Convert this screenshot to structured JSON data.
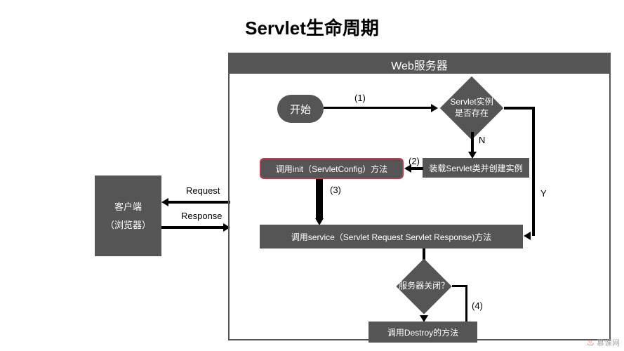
{
  "title": "Servlet生命周期",
  "client": {
    "line1": "客户端",
    "line2": "（浏览器）"
  },
  "server_header": "Web服务器",
  "nodes": {
    "start": "开始",
    "exists_l1": "Servlet实例",
    "exists_l2": "是否存在",
    "load": "装载Servlet类并创建实例",
    "init": "调用init（ServletConfig）方法",
    "service": "调用service（Servlet Request Servlet Response)方法",
    "shutdown": "服务器关闭？",
    "destroy": "调用Destroy的方法"
  },
  "labels": {
    "request": "Request",
    "response": "Response",
    "step1": "(1)",
    "step2": "(2)",
    "step3": "(3)",
    "step4": "(4)",
    "N": "N",
    "Y": "Y"
  },
  "watermark": "慕课网",
  "chart_data": {
    "type": "flowchart",
    "title": "Servlet生命周期",
    "container": "Web服务器",
    "external": {
      "id": "client",
      "label": "客户端（浏览器）"
    },
    "nodes": [
      {
        "id": "start",
        "shape": "terminator",
        "label": "开始"
      },
      {
        "id": "exists",
        "shape": "decision",
        "label": "Servlet实例是否存在"
      },
      {
        "id": "load",
        "shape": "process",
        "label": "装载Servlet类并创建实例"
      },
      {
        "id": "init",
        "shape": "process",
        "label": "调用init（ServletConfig）方法",
        "highlighted": true
      },
      {
        "id": "service",
        "shape": "process",
        "label": "调用service（Servlet Request Servlet Response)方法"
      },
      {
        "id": "shutdown",
        "shape": "decision",
        "label": "服务器关闭？"
      },
      {
        "id": "destroy",
        "shape": "process",
        "label": "调用Destroy的方法"
      }
    ],
    "edges": [
      {
        "from": "start",
        "to": "exists",
        "label": "(1)"
      },
      {
        "from": "exists",
        "to": "load",
        "label": "N"
      },
      {
        "from": "exists",
        "to": "service",
        "label": "Y"
      },
      {
        "from": "load",
        "to": "init",
        "label": "(2)"
      },
      {
        "from": "init",
        "to": "service",
        "label": "(3)"
      },
      {
        "from": "service",
        "to": "shutdown",
        "label": ""
      },
      {
        "from": "shutdown",
        "to": "destroy",
        "label": "(4)"
      },
      {
        "from": "client",
        "to": "server",
        "label": "Request"
      },
      {
        "from": "server",
        "to": "client",
        "label": "Response"
      }
    ]
  }
}
